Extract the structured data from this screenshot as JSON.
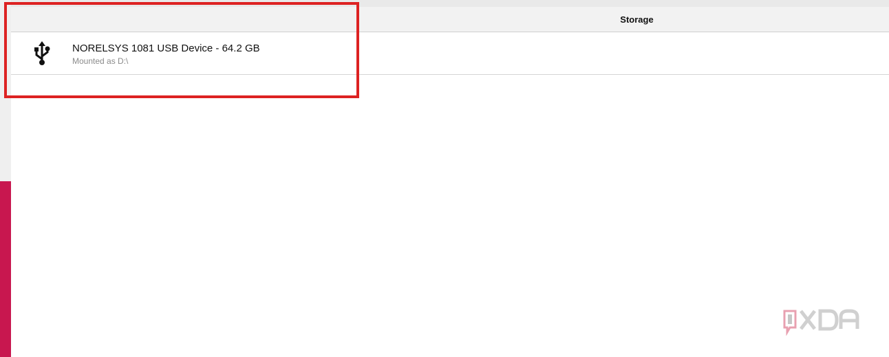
{
  "header": {
    "title": "Storage"
  },
  "devices": [
    {
      "name": "NORELSYS 1081 USB Device - 64.2 GB",
      "subtitle": "Mounted as D:\\",
      "icon": "usb-icon"
    }
  ],
  "watermark": {
    "text": "XDA"
  },
  "colors": {
    "highlight": "#dd2222",
    "accent_bar": "#c8174f"
  }
}
